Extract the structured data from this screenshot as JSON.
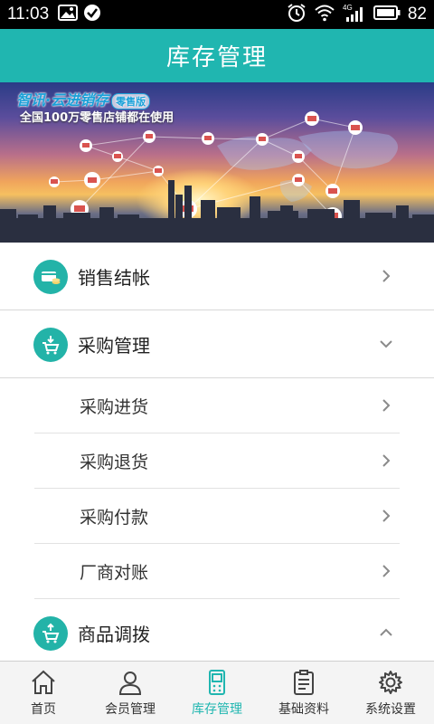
{
  "status_bar": {
    "time": "11:03",
    "battery": "82",
    "network": "4G"
  },
  "header": {
    "title": "库存管理"
  },
  "banner": {
    "brand": "智讯·云进销存",
    "brand_tag": "零售版",
    "slogan": "全国100万零售店铺都在使用"
  },
  "menu": {
    "sales_checkout": "销售结帐",
    "purchase_management": "采购管理",
    "purchase_sub": [
      "采购进货",
      "采购退货",
      "采购付款",
      "厂商对账"
    ],
    "goods_transfer": "商品调拨"
  },
  "tabbar": {
    "home": "首页",
    "members": "会员管理",
    "inventory": "库存管理",
    "basic_data": "基础资料",
    "settings": "系统设置"
  },
  "colors": {
    "accent": "#20b6b0",
    "icon_bg": "#23b3a8"
  }
}
